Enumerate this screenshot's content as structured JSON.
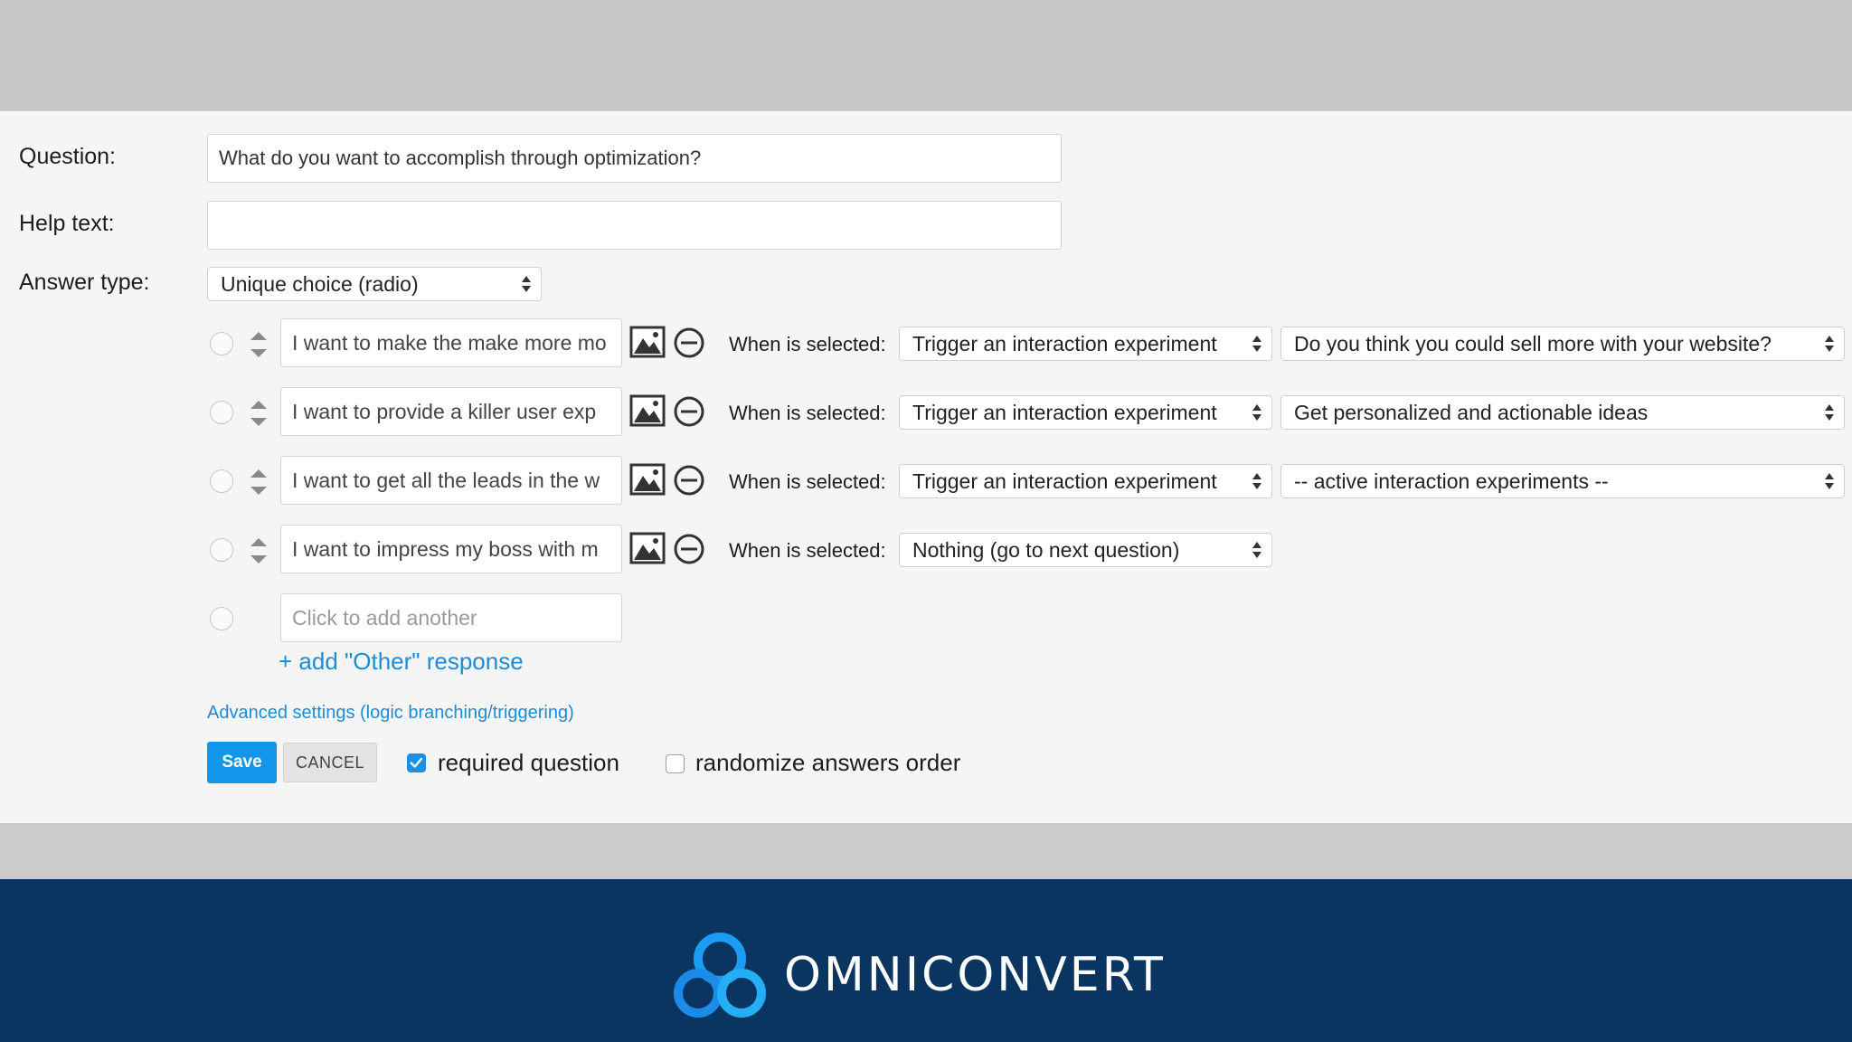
{
  "form": {
    "question_label": "Question:",
    "question_value": "What do you want to accomplish through optimization?",
    "helptext_label": "Help text:",
    "helptext_value": "",
    "answer_type_label": "Answer type:",
    "answer_type_value": "Unique choice (radio)",
    "when_selected_label": "When is selected:",
    "answers": [
      {
        "text": "I want to make the make more mo",
        "action": "Trigger an interaction experiment",
        "target": "Do you think you could sell more with your website?"
      },
      {
        "text": "I want to provide a killer user exp",
        "action": "Trigger an interaction experiment",
        "target": "Get personalized and actionable ideas"
      },
      {
        "text": "I want to get all the leads in the w",
        "action": "Trigger an interaction experiment",
        "target": "-- active interaction experiments --"
      },
      {
        "text": "I want to impress my boss with m",
        "action": "Nothing (go to next question)"
      }
    ],
    "add_another_placeholder": "Click to add another",
    "add_other_link": "+ add \"Other\" response",
    "advanced_link": "Advanced settings (logic branching/triggering)",
    "save_label": "Save",
    "cancel_label": "CANCEL",
    "required_label": "required question",
    "required_checked": true,
    "randomize_label": "randomize answers order",
    "randomize_checked": false
  },
  "footer": {
    "brand": "OMNICONVERT",
    "logo_icon": "three-rings-logo-icon"
  },
  "colors": {
    "accent": "#1196ea",
    "link": "#1a8cd8",
    "footer_bg": "#0b3561",
    "logo_blue": "#1c9cf2"
  }
}
